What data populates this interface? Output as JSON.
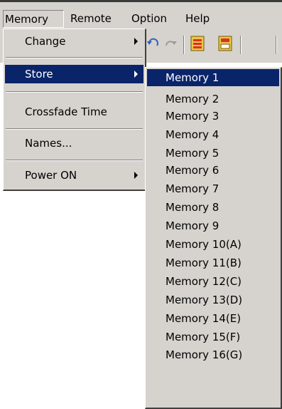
{
  "menubar": {
    "items": [
      {
        "label": "Memory"
      },
      {
        "label": "Remote"
      },
      {
        "label": "Option"
      },
      {
        "label": "Help"
      }
    ]
  },
  "memory_menu": {
    "items": [
      {
        "label": "Change"
      },
      {
        "label": "Store"
      },
      {
        "label": "Crossfade Time"
      },
      {
        "label": "Names..."
      },
      {
        "label": "Power ON"
      }
    ]
  },
  "store_submenu": {
    "items": [
      "Memory 1",
      "Memory 2",
      "Memory 3",
      "Memory 4",
      "Memory 5",
      "Memory 6",
      "Memory 7",
      "Memory 8",
      "Memory 9",
      "Memory 10(A)",
      "Memory 11(B)",
      "Memory 12(C)",
      "Memory 13(D)",
      "Memory 14(E)",
      "Memory 15(F)",
      "Memory 16(G)"
    ]
  },
  "colors": {
    "highlight": "#0a246a",
    "face": "#d6d3ce"
  },
  "icons": [
    "undo-icon",
    "redo-icon",
    "store-icon",
    "recall-icon"
  ]
}
